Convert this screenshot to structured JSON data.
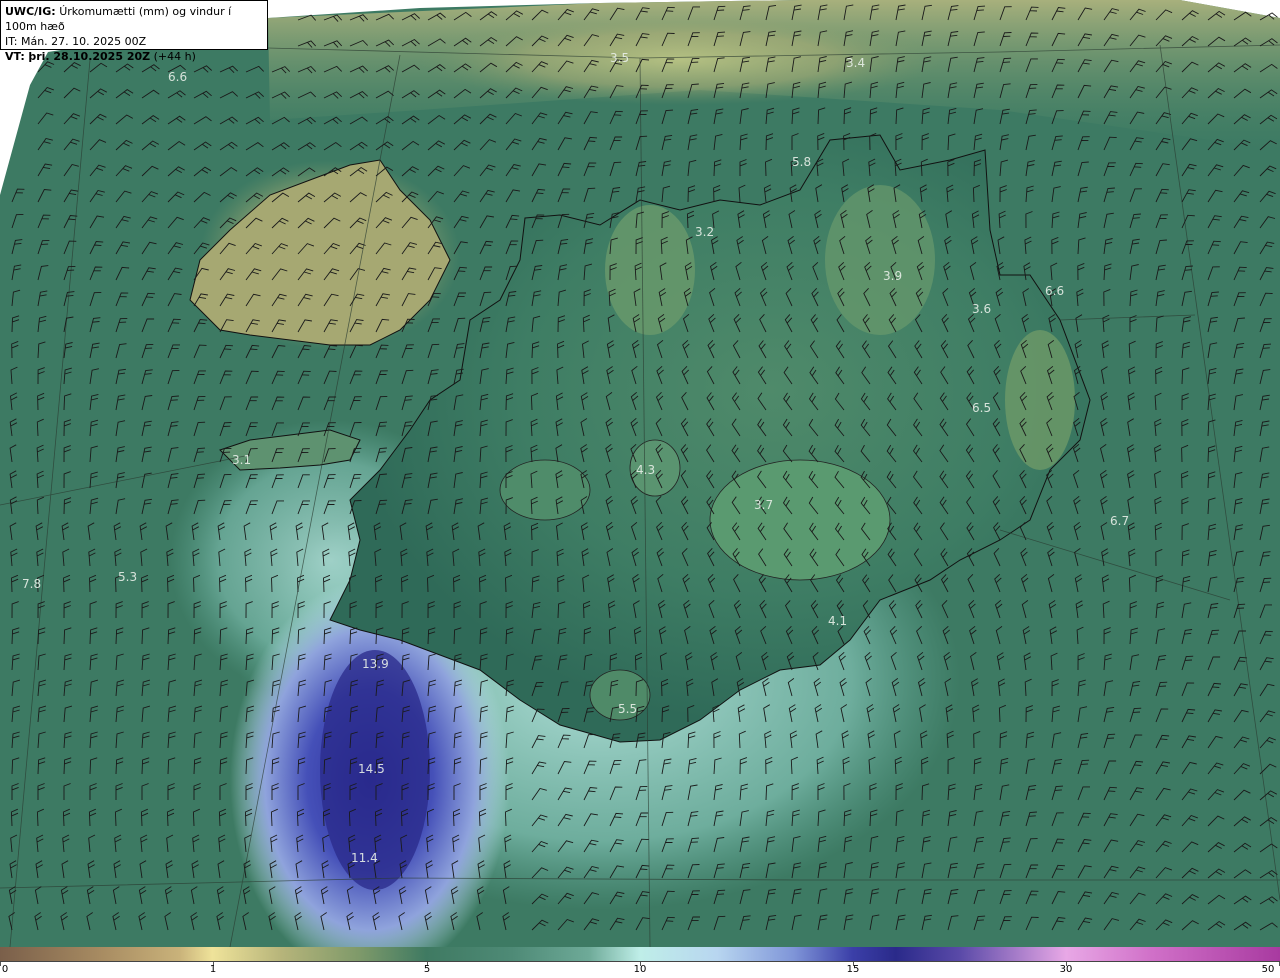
{
  "header": {
    "model": "UWC/IG:",
    "title": "Úrkomumætti (mm) og vindur í 100m hæð",
    "initial_time": "IT: Mán. 27. 10. 2025 00Z",
    "valid_prefix": "VT:",
    "valid_time": "þri. 28.10.2025 20Z",
    "valid_offset": "(+44 h)"
  },
  "map_labels": [
    "3.5",
    "3.4",
    "6.6",
    "5.8",
    "3.2",
    "3.9",
    "6.6",
    "3.6",
    "6.5",
    "3.1",
    "4.3",
    "3.7",
    "6.7",
    "7.8",
    "5.3",
    "4.1",
    "13.9",
    "5.5",
    "14.5",
    "11.4"
  ],
  "colorbar": {
    "ticks": [
      "0",
      "1",
      "5",
      "10",
      "15",
      "30",
      "50"
    ],
    "colors": {
      "low": "#7a5f4a",
      "mid_dry": "#efe39a",
      "green": "#3f7a62",
      "cyan": "#bfeee8",
      "blue": "#3b3fa8",
      "magenta": "#a83aa0"
    }
  }
}
